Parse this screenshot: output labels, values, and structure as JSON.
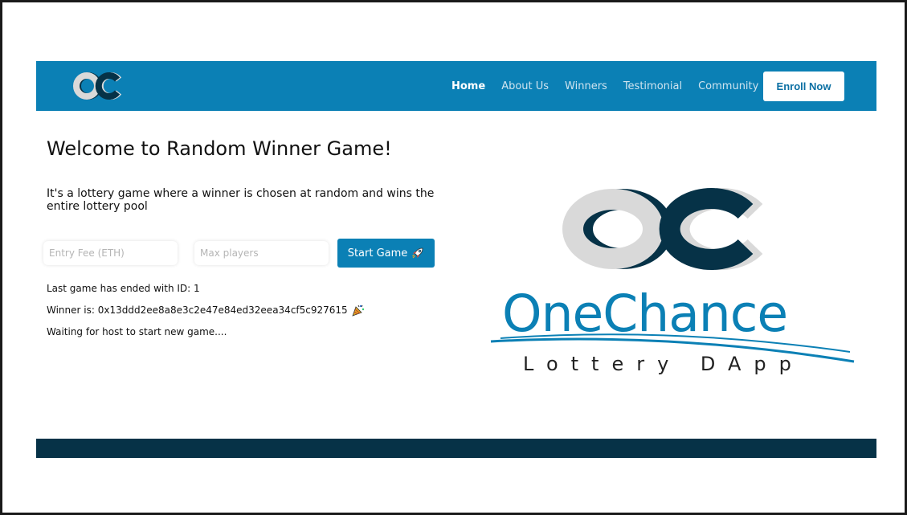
{
  "navbar": {
    "logo_text": "OC",
    "links": [
      {
        "label": "Home",
        "active": true
      },
      {
        "label": "About Us",
        "active": false
      },
      {
        "label": "Winners",
        "active": false
      },
      {
        "label": "Testimonial",
        "active": false
      },
      {
        "label": "Community",
        "active": false
      }
    ],
    "enroll_label": "Enroll Now"
  },
  "hero": {
    "title": "Welcome to Random Winner Game!",
    "description": "It's a lottery game where a winner is chosen at random and wins the entire lottery pool"
  },
  "form": {
    "fee_placeholder": "Entry Fee (ETH)",
    "players_placeholder": "Max players",
    "start_label": "Start Game",
    "start_icon": "rocket-icon"
  },
  "status": {
    "last_game": "Last game has ended with ID: 1",
    "winner": "Winner is: 0x13ddd2ee8a8e3c2e47e84ed32eea34cf5c927615",
    "winner_icon": "party-popper-icon",
    "waiting": "Waiting for host to start new game...."
  },
  "brand": {
    "logo_text": "OC",
    "name": "OneChance",
    "tagline": "Lottery DApp"
  },
  "colors": {
    "primary_blue": "#0b80b5",
    "dark_navy": "#063247",
    "logo_gray": "#d9d9d9",
    "white": "#ffffff"
  }
}
